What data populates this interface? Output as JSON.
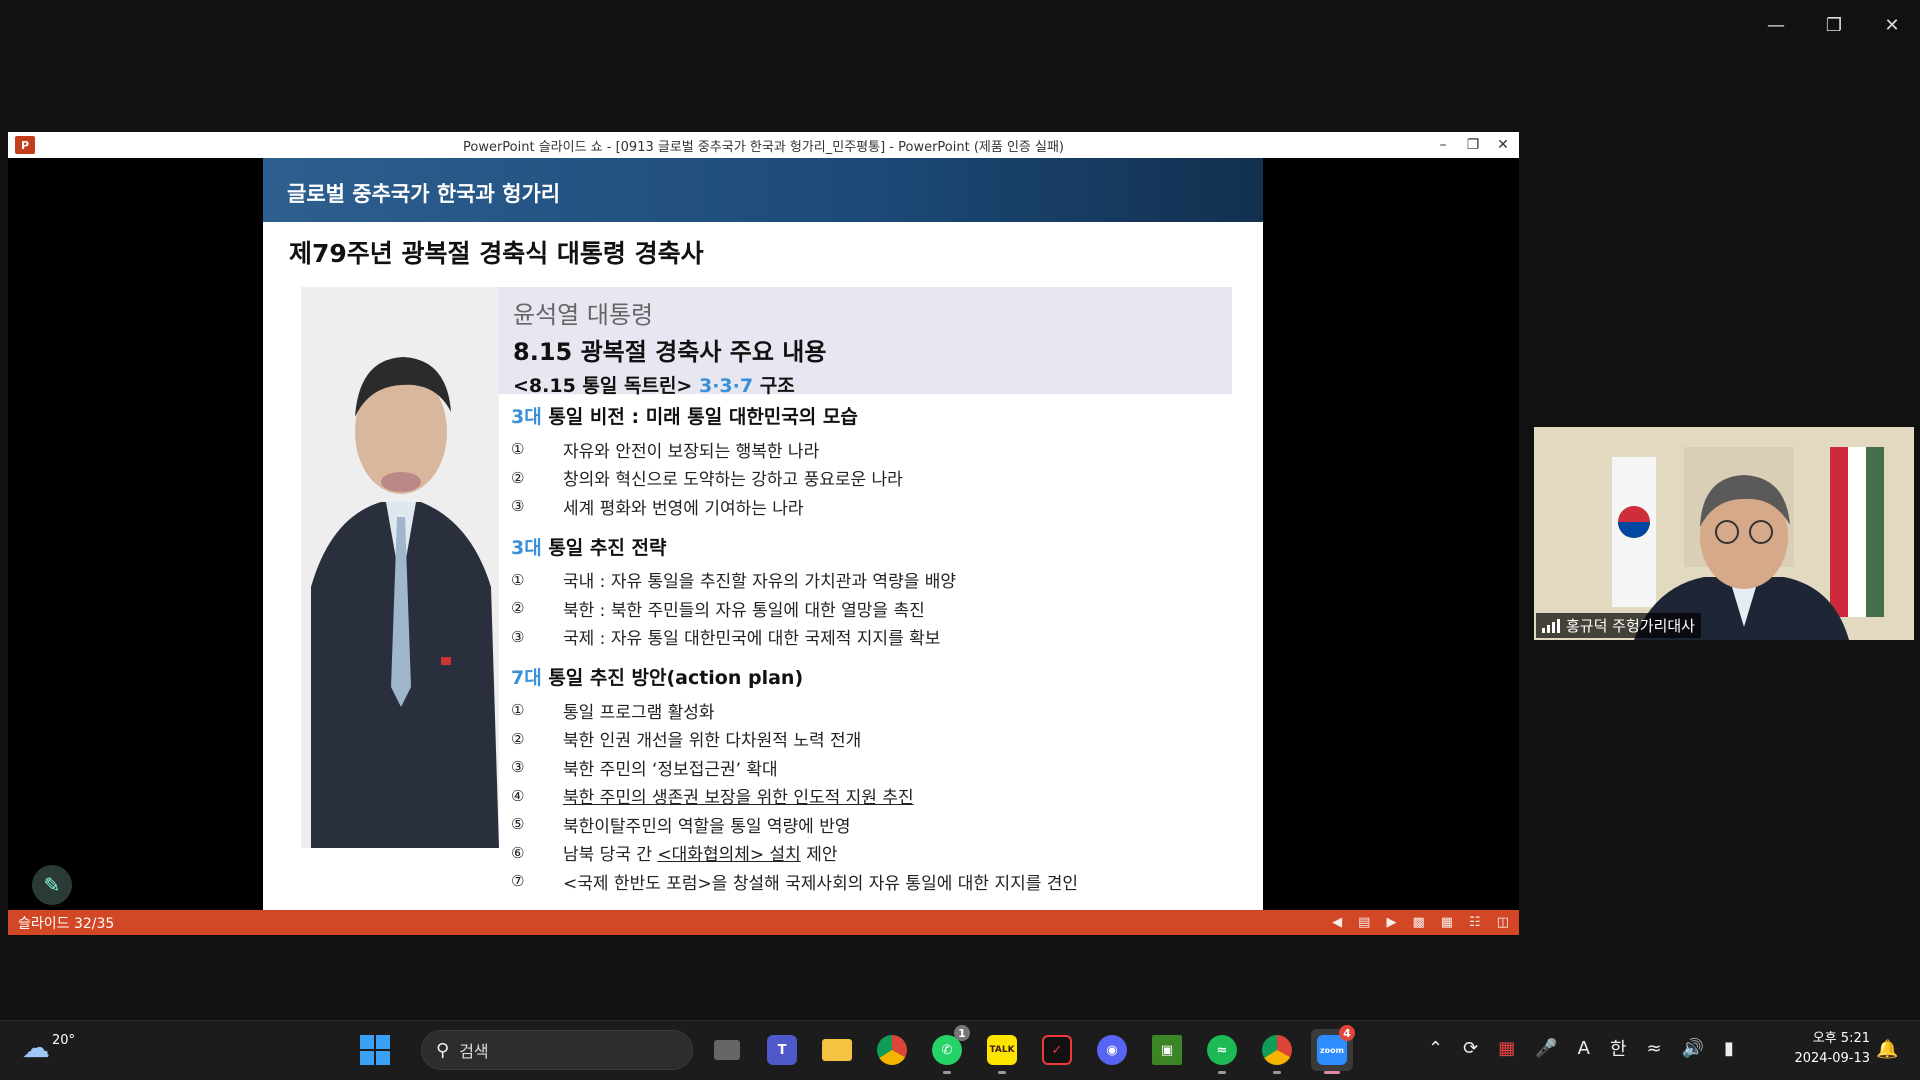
{
  "zoom_window": {
    "minimize_icon": "minimize-icon",
    "restore_icon": "restore-icon",
    "close_icon": "close-icon"
  },
  "ppt": {
    "logo": "P",
    "window_title": "PowerPoint 슬라이드 쇼 - [0913 글로벌 중추국가 한국과 헝가리_민주평통] - PowerPoint (제품 인증 실패)",
    "status_slide": "슬라이드 32/35"
  },
  "slide": {
    "banner": "글로벌 중추국가 한국과 헝가리",
    "heading": "제79주년 광복절 경축식 대통령 경축사",
    "box_line1": "윤석열 대통령",
    "box_line2": "8.15 광복절 경축사 주요 내용",
    "box_line3_prefix": "<8.15 통일 독트린>",
    "box_line3_blue": "3·3·7",
    "box_line3_suffix": "구조",
    "sections": [
      {
        "num": "3대",
        "title": "통일 비전 : 미래 통일 대한민국의 모습",
        "items": [
          {
            "n": "①",
            "t": "자유와 안전이 보장되는 행복한 나라"
          },
          {
            "n": "②",
            "t": "창의와 혁신으로 도약하는 강하고 풍요로운 나라"
          },
          {
            "n": "③",
            "t": "세계 평화와 번영에 기여하는 나라"
          }
        ]
      },
      {
        "num": "3대",
        "title": "통일 추진 전략",
        "items": [
          {
            "n": "①",
            "t": "국내 : 자유 통일을 추진할 자유의 가치관과 역량을 배양"
          },
          {
            "n": "②",
            "t": "북한 : 북한 주민들의 자유 통일에 대한 열망을 촉진"
          },
          {
            "n": "③",
            "t": "국제 : 자유 통일 대한민국에 대한 국제적 지지를 확보"
          }
        ]
      },
      {
        "num": "7대",
        "title": "통일 추진 방안(action plan)",
        "items": [
          {
            "n": "①",
            "t": "통일 프로그램 활성화"
          },
          {
            "n": "②",
            "t": "북한 인권 개선을 위한 다차원적 노력 전개"
          },
          {
            "n": "③",
            "t": "북한 주민의 ‘정보접근권’ 확대"
          },
          {
            "n": "④",
            "t": "북한 주민의 생존권 보장을 위한 인도적 지원 추진"
          },
          {
            "n": "⑤",
            "t": "북한이탈주민의 역할을 통일 역량에 반영"
          },
          {
            "n": "⑥",
            "t_prefix": "남북 당국 간 ",
            "t_underline": "<대화협의체> 설치",
            "t_suffix": " 제안"
          },
          {
            "n": "⑦",
            "t": "<국제 한반도 포럼>을 창설해 국제사회의 자유 통일에 대한 지지를 견인"
          }
        ]
      }
    ]
  },
  "video": {
    "participant_name": "홍규덕 주헝가리대사"
  },
  "taskbar": {
    "weather_temp": "20°",
    "search_label": "검색",
    "apps": [
      {
        "name": "task-view",
        "badge": ""
      },
      {
        "name": "teams",
        "badge": ""
      },
      {
        "name": "file-explorer",
        "badge": ""
      },
      {
        "name": "chrome",
        "badge": ""
      },
      {
        "name": "whatsapp",
        "badge": "1"
      },
      {
        "name": "kakaotalk",
        "badge": ""
      },
      {
        "name": "vivaldi",
        "badge": ""
      },
      {
        "name": "discord",
        "badge": ""
      },
      {
        "name": "minecraft",
        "badge": ""
      },
      {
        "name": "spotify",
        "badge": ""
      },
      {
        "name": "chrome-profile",
        "badge": ""
      },
      {
        "name": "zoom",
        "badge": "4"
      }
    ],
    "kakao_label": "TALK",
    "zoom_label": "zoom",
    "ime_a": "A",
    "ime_han": "한",
    "clock_time": "오후 5:21",
    "clock_date": "2024-09-13"
  }
}
